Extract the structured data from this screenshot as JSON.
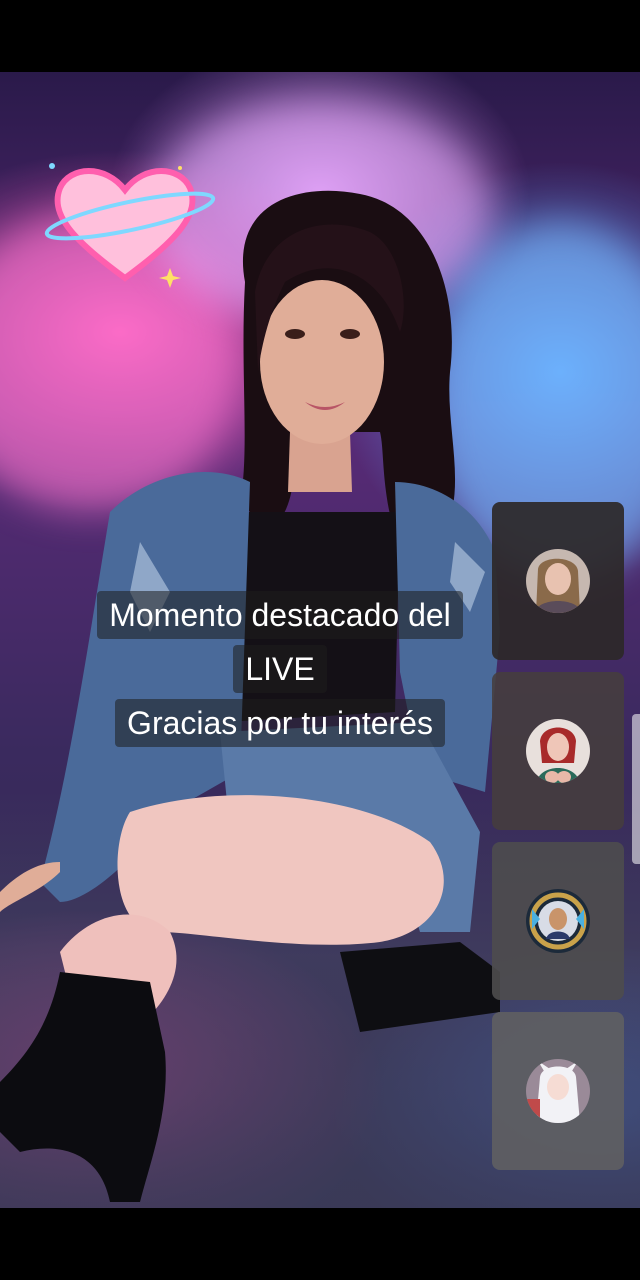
{
  "app": {
    "screen": "tiktok-live-replay"
  },
  "caption": {
    "line1": "Momento destacado del",
    "line2": "LIVE",
    "line3": "Gracias por tu interés"
  },
  "guests": [
    {
      "name": "",
      "avatar": "avatar-woman-light-hair"
    },
    {
      "name": "",
      "avatar": "avatar-woman-red-hair"
    },
    {
      "name": "",
      "avatar": "avatar-man-cartoon-frame"
    },
    {
      "name": "",
      "avatar": "avatar-anime-girl-white-hair"
    }
  ],
  "colors": {
    "caption_bg": "#1e1e1e",
    "caption_text": "#ffffff",
    "neon_pink": "#ff5fbe",
    "neon_blue": "#5aaaff"
  },
  "sticker": {
    "icon": "heart-sticker-icon"
  }
}
